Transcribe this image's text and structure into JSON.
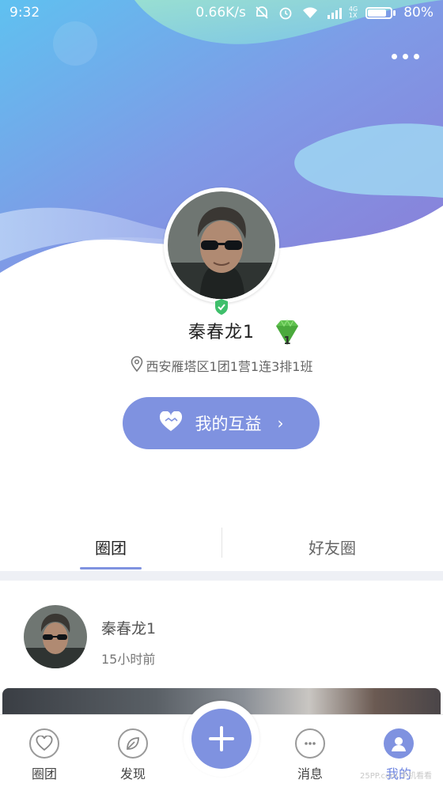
{
  "status_bar": {
    "time": "9:32",
    "network_speed": "0.66K/s",
    "signal_label_top": "4G",
    "signal_label_bottom": "1X",
    "battery_percent": "80%",
    "battery_level": 0.8
  },
  "header": {
    "more_icon": "more-dots-icon"
  },
  "profile": {
    "name": "秦春龙1",
    "level_badge": "1",
    "location": "西安雁塔区1团1营1连3排1班",
    "verified_icon": "shield-check-icon",
    "gem_icon": "green-diamond-icon"
  },
  "huyi_button": {
    "label": "我的互益",
    "icon": "handshake-heart-icon",
    "arrow": "›"
  },
  "tabs": [
    {
      "label": "圈团",
      "active": true
    },
    {
      "label": "好友圈",
      "active": false
    }
  ],
  "post": {
    "author": "秦春龙1",
    "time": "15小时前"
  },
  "bottom_nav": {
    "items": [
      {
        "label": "圈团",
        "icon": "heart-icon"
      },
      {
        "label": "发现",
        "icon": "leaf-icon"
      },
      {
        "label": "消息",
        "icon": "chat-icon"
      },
      {
        "label": "我的",
        "icon": "user-icon"
      }
    ],
    "add_icon": "plus-icon"
  },
  "colors": {
    "accent": "#7f92e0",
    "verified_green": "#3fbf6b"
  },
  "watermark": "25PP.com 手机看看"
}
